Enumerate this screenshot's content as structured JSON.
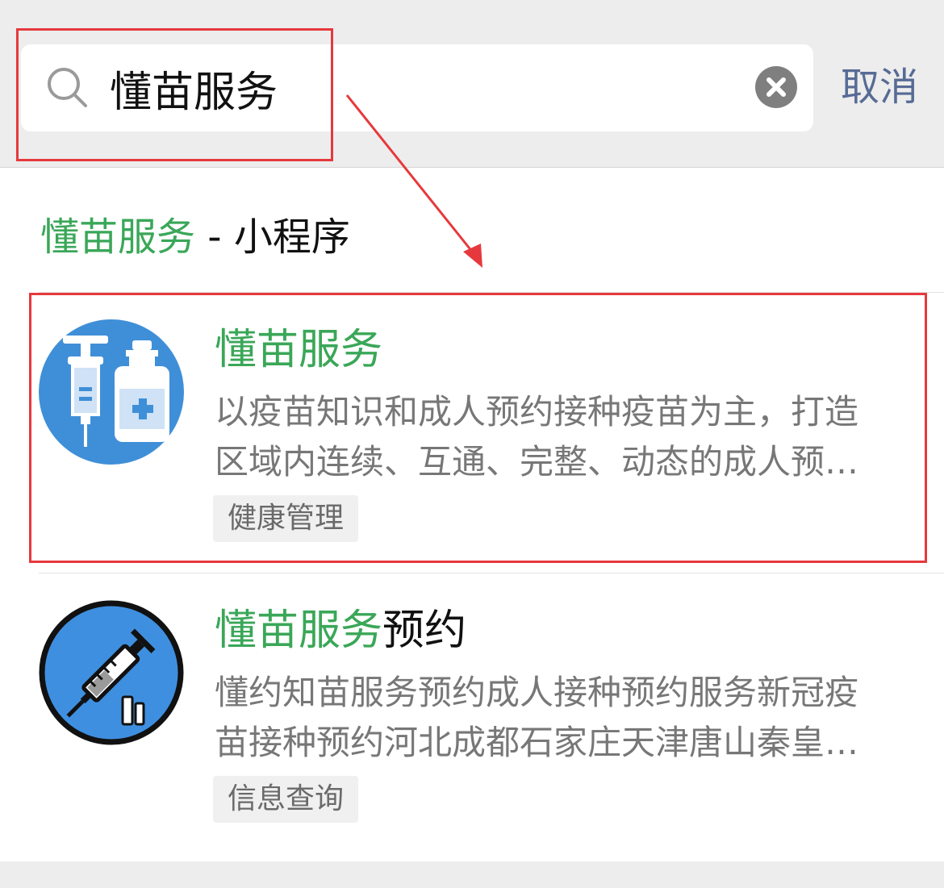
{
  "search": {
    "query": "懂苗服务",
    "cancel_label": "取消"
  },
  "section": {
    "highlight": "懂苗服务",
    "suffix": " - 小程序"
  },
  "results": [
    {
      "title_highlight": "懂苗服务",
      "title_suffix": "",
      "desc_line1": "以疫苗知识和成人预约接种疫苗为主，打造",
      "desc_line2": "区域内连续、互通、完整、动态的成人预…",
      "tag": "健康管理",
      "icon": "vaccine-syringe-bottle-icon"
    },
    {
      "title_highlight": "懂苗服务",
      "title_suffix": "预约",
      "desc_line1": "懂约知苗服务预约成人接种预约服务新冠疫",
      "desc_line2": "苗接种预约河北成都石家庄天津唐山秦皇…",
      "tag": "信息查询",
      "icon": "syringe-icon"
    }
  ],
  "colors": {
    "highlight": "#3aa758",
    "link": "#576b95",
    "annotation": "#e6393d"
  }
}
